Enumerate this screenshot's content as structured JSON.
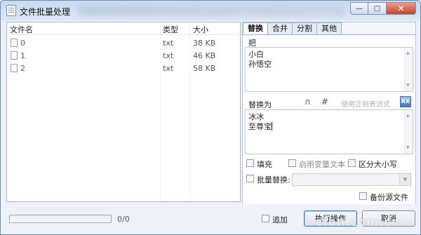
{
  "window": {
    "title": "文件批量处理",
    "minimize_glyph": "—",
    "maximize_glyph": "□",
    "close_glyph": "✕"
  },
  "file_list": {
    "columns": [
      "文件名",
      "类型",
      "大小"
    ],
    "rows": [
      {
        "name": "0",
        "type": "txt",
        "size": "38 KB"
      },
      {
        "name": "1",
        "type": "txt",
        "size": "46 KB"
      },
      {
        "name": "2",
        "type": "txt",
        "size": "58 KB"
      }
    ]
  },
  "tabs": [
    {
      "label": "替换",
      "active": true
    },
    {
      "label": "合并",
      "active": false
    },
    {
      "label": "分割",
      "active": false
    },
    {
      "label": "其他",
      "active": false
    }
  ],
  "replace": {
    "find_label": "把",
    "find_lines": [
      "小白",
      "孙悟空"
    ],
    "replace_label": "替换为",
    "regex_label": "使用正则表达式",
    "replace_lines": [
      "冰冰",
      "至尊宝"
    ],
    "options": {
      "fill": "填充",
      "use_variable_text": "启用变量文本",
      "case_sensitive": "区分大小写",
      "batch_replace": "批量替换:",
      "backup_source": "备份源文件"
    }
  },
  "bottom": {
    "progress_text": "0/0",
    "progress_fraction": 0,
    "append_label": "追加",
    "execute_label": "执行操作",
    "cancel_label": "取消"
  },
  "watermark": "cfan.com.cn",
  "icons": {
    "app": "document-icon",
    "magnet": "magnet-icon",
    "hash": "hash-icon",
    "regex": "regex-tool-icon"
  }
}
